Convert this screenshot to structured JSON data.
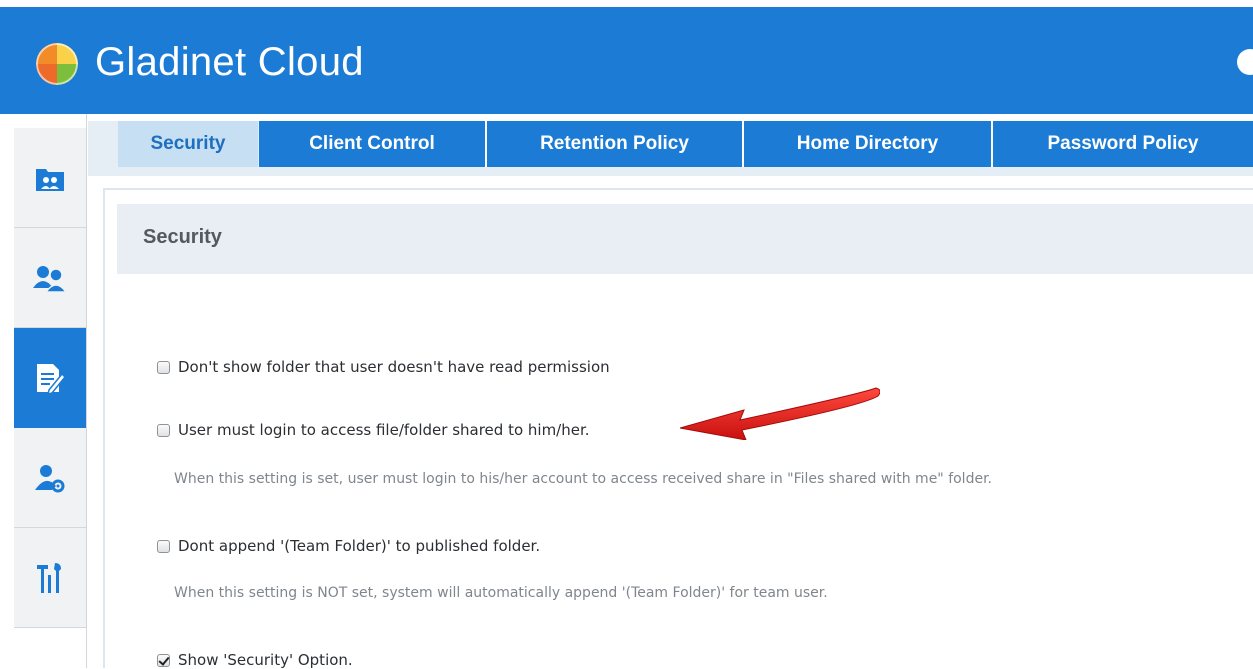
{
  "app": {
    "title": "Gladinet Cloud"
  },
  "colors": {
    "brand": "#1c7cd5",
    "active_tab_bg": "#c6dff2",
    "active_tab_text": "#1e6fbf",
    "arrow": "#e01d1d"
  },
  "sidebar": {
    "items": [
      {
        "icon": "team-folder-icon",
        "active": false
      },
      {
        "icon": "users-icon",
        "active": false
      },
      {
        "icon": "document-edit-icon",
        "active": true
      },
      {
        "icon": "user-settings-icon",
        "active": false
      },
      {
        "icon": "tools-icon",
        "active": false
      }
    ]
  },
  "tabs": [
    {
      "label": "Security",
      "active": true
    },
    {
      "label": "Client Control",
      "active": false
    },
    {
      "label": "Retention Policy",
      "active": false
    },
    {
      "label": "Home Directory",
      "active": false
    },
    {
      "label": "Password Policy",
      "active": false
    }
  ],
  "panel": {
    "title": "Security",
    "options": [
      {
        "label": "Don't show folder that user doesn't have read permission",
        "checked": false,
        "description": ""
      },
      {
        "label": "User must login to access file/folder shared to him/her.",
        "checked": false,
        "description": "When this setting is set, user must login to his/her account to access received share in \"Files shared with me\" folder."
      },
      {
        "label": "Dont append '(Team Folder)' to published folder.",
        "checked": false,
        "description": "When this setting is NOT set, system will automatically append '(Team Folder)' for team user."
      },
      {
        "label": "Show 'Security' Option.",
        "checked": true,
        "description": ""
      }
    ]
  }
}
